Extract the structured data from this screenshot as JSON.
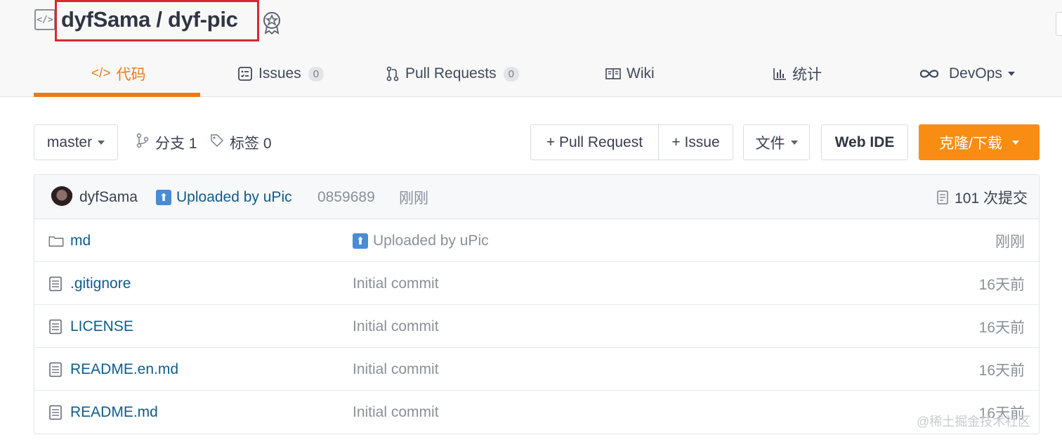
{
  "header": {
    "repo_title": "dyfSama / dyf-pic",
    "repo_icon": "code-icon",
    "badge_icon": "recommend-badge-icon"
  },
  "tabs": [
    {
      "label": "代码",
      "icon": "code-icon",
      "active": true
    },
    {
      "label": "Issues",
      "icon": "issues-icon",
      "count": "0"
    },
    {
      "label": "Pull Requests",
      "icon": "pull-request-icon",
      "count": "0"
    },
    {
      "label": "Wiki",
      "icon": "book-icon"
    },
    {
      "label": "统计",
      "icon": "bar-chart-icon"
    },
    {
      "label": "DevOps",
      "icon": "infinity-icon"
    }
  ],
  "toolbar": {
    "branch": "master",
    "branches_label": "分支 1",
    "tags_label": "标签 0",
    "pull_request_btn": "+ Pull Request",
    "issue_btn": "+ Issue",
    "file_btn": "文件",
    "webide_btn": "Web IDE",
    "clone_btn": "克隆/下载"
  },
  "commit": {
    "author": "dyfSama",
    "message": "Uploaded by uPic",
    "hash": "0859689",
    "time": "刚刚",
    "commit_count": "101 次提交"
  },
  "files": [
    {
      "name": "md",
      "type": "folder",
      "message": "Uploaded by uPic",
      "time": "刚刚"
    },
    {
      "name": ".gitignore",
      "type": "file",
      "message": "Initial commit",
      "time": "16天前"
    },
    {
      "name": "LICENSE",
      "type": "file",
      "message": "Initial commit",
      "time": "16天前"
    },
    {
      "name": "README.en.md",
      "type": "file",
      "message": "Initial commit",
      "time": "16天前"
    },
    {
      "name": "README.md",
      "type": "file",
      "message": "Initial commit",
      "time": "16天前"
    }
  ],
  "watermark": "@稀土掘金技术社区",
  "colors": {
    "accent": "#f07a10",
    "clone": "#f98d13",
    "link": "#0f5c8a",
    "highlight_box": "#d62a30"
  }
}
